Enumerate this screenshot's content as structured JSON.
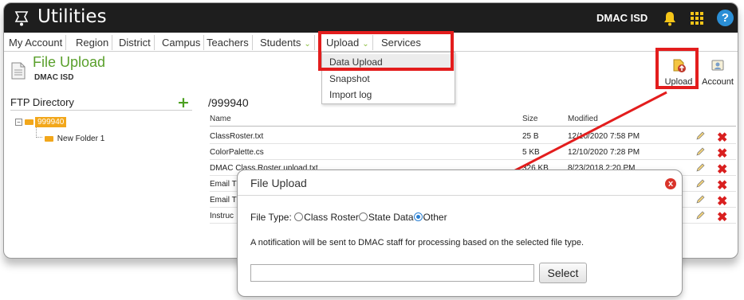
{
  "app": {
    "title": "Utilities",
    "org": "DMAC ISD",
    "help": "?"
  },
  "nav": {
    "items": [
      {
        "label": "My Account"
      },
      {
        "label": "Region"
      },
      {
        "label": "District"
      },
      {
        "label": "Campus"
      },
      {
        "label": "Teachers"
      },
      {
        "label": "Students"
      },
      {
        "label": "Upload"
      },
      {
        "label": "Services"
      }
    ],
    "dropdown_chevron": "⌄"
  },
  "dropdown": {
    "items": [
      {
        "label": "Data Upload"
      },
      {
        "label": "Snapshot"
      },
      {
        "label": "Import log"
      }
    ]
  },
  "page": {
    "title": "File Upload",
    "subtitle": "DMAC ISD"
  },
  "toolbar": {
    "upload_label": "Upload",
    "account_label": "Account"
  },
  "ftp": {
    "header": "FTP Directory",
    "root_folder": "999940",
    "expander": "−",
    "child_folder": "New Folder 1"
  },
  "files": {
    "path": "/999940",
    "columns": {
      "name": "Name",
      "size": "Size",
      "modified": "Modified"
    },
    "rows": [
      {
        "name": "ClassRoster.txt",
        "size": "25 B",
        "modified": "12/10/2020 7:58 PM"
      },
      {
        "name": "ColorPalette.cs",
        "size": "5 KB",
        "modified": "12/10/2020 7:28 PM"
      },
      {
        "name": "DMAC Class Roster upload.txt",
        "size": "326 KB",
        "modified": "8/23/2018 2:20 PM"
      },
      {
        "name": "Email T",
        "size": "",
        "modified": ""
      },
      {
        "name": "Email T",
        "size": "",
        "modified": ""
      },
      {
        "name": "Instruc",
        "size": "",
        "modified": ""
      }
    ]
  },
  "modal": {
    "title": "File Upload",
    "close": "x",
    "file_type_label": "File Type:",
    "options": [
      {
        "label": "Class Roster",
        "checked": false
      },
      {
        "label": "State Data",
        "checked": false
      },
      {
        "label": "Other",
        "checked": true
      }
    ],
    "notice": "A notification will be sent to DMAC staff for processing based on the selected file type.",
    "file_input_value": "",
    "select_label": "Select"
  },
  "colors": {
    "topbar": "#1e1e1e",
    "brand_green": "#5aa02c",
    "highlight_red": "#e31d1d",
    "delete_red": "#d91f1f",
    "folder_orange": "#f2a71b",
    "help_blue": "#2b8fd6"
  },
  "icons": {
    "app": "utilities-icon",
    "bell": "bell-icon",
    "grid": "apps-grid-icon",
    "help": "help-icon",
    "add": "plus-icon",
    "edit": "edit-icon",
    "delete": "delete-icon",
    "close": "close-icon",
    "upload": "upload-icon",
    "account": "account-icon",
    "page": "document-icon"
  }
}
